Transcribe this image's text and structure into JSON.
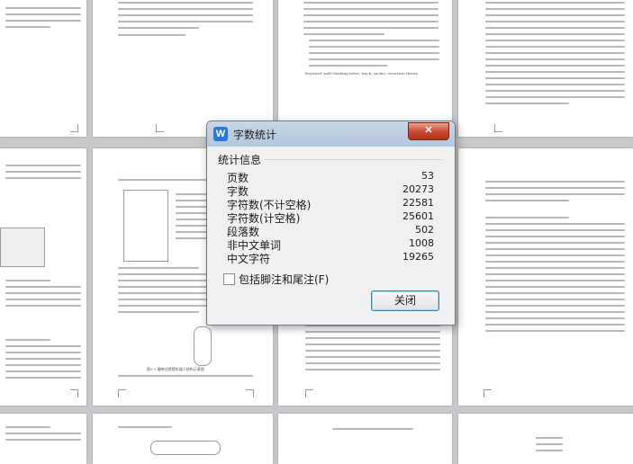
{
  "dialog": {
    "title": "字数统计",
    "app_icon": "W",
    "group_title": "统计信息",
    "stats": [
      {
        "label": "页数",
        "value": "53"
      },
      {
        "label": "字数",
        "value": "20273"
      },
      {
        "label": "字符数(不计空格)",
        "value": "22581"
      },
      {
        "label": "字符数(计空格)",
        "value": "25601"
      },
      {
        "label": "段落数",
        "value": "502"
      },
      {
        "label": "非中文单词",
        "value": "1008"
      },
      {
        "label": "中文字符",
        "value": "19265"
      }
    ],
    "include_footnotes_label": "包括脚注和尾注(F)",
    "include_footnotes_checked": false,
    "close_button_label": "关闭",
    "window_close_glyph": "✕"
  },
  "background": {
    "keywords_line": "Keyword: wall-climbing robot; track; sucker; structure theory",
    "figure_caption": "图3-1 履带式爬壁机器人结构示意图"
  }
}
